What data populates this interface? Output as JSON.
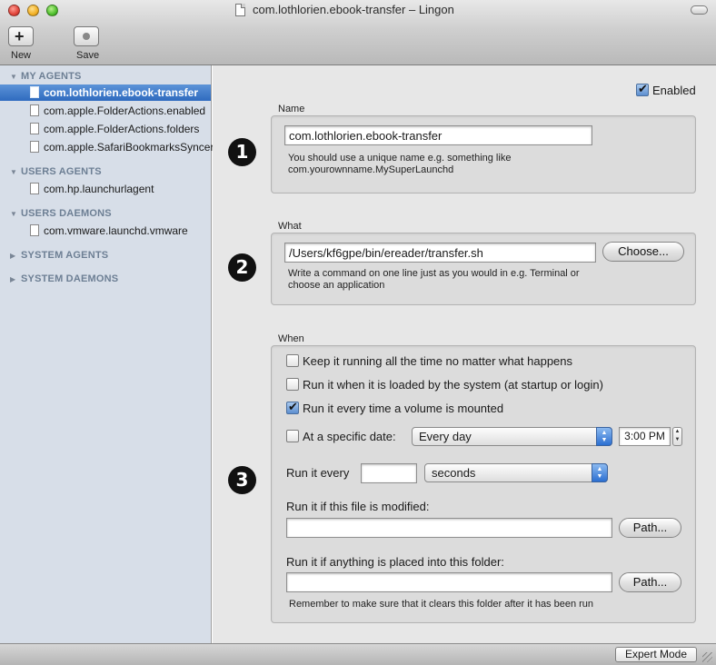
{
  "window": {
    "title": "com.lothlorien.ebook-transfer – Lingon"
  },
  "toolbar": {
    "new_label": "New",
    "save_label": "Save"
  },
  "sidebar": {
    "groups": [
      {
        "label": "MY AGENTS",
        "expanded": true,
        "items": [
          "com.lothlorien.ebook-transfer",
          "com.apple.FolderActions.enabled",
          "com.apple.FolderActions.folders",
          "com.apple.SafariBookmarksSyncer"
        ]
      },
      {
        "label": "USERS AGENTS",
        "expanded": true,
        "items": [
          "com.hp.launchurlagent"
        ]
      },
      {
        "label": "USERS DAEMONS",
        "expanded": true,
        "items": [
          "com.vmware.launchd.vmware"
        ]
      },
      {
        "label": "SYSTEM AGENTS",
        "expanded": false,
        "items": []
      },
      {
        "label": "SYSTEM DAEMONS",
        "expanded": false,
        "items": []
      }
    ],
    "selected_item": "com.lothlorien.ebook-transfer"
  },
  "main": {
    "enabled_label": "Enabled",
    "enabled_checked": true,
    "name_section": {
      "badge": "1",
      "title": "Name",
      "value": "com.lothlorien.ebook-transfer",
      "hint_line1": "You should use a unique name e.g. something like",
      "hint_line2": "com.yourownname.MySuperLaunchd"
    },
    "what_section": {
      "badge": "2",
      "title": "What",
      "value": "/Users/kf6gpe/bin/ereader/transfer.sh",
      "choose_label": "Choose...",
      "hint_line1": "Write a command on one line just as you would in e.g. Terminal or",
      "hint_line2": "choose an application"
    },
    "when_section": {
      "badge": "3",
      "title": "When",
      "keep_running_label": "Keep it running all the time no matter what happens",
      "keep_running_checked": false,
      "run_loaded_label": "Run it when it is loaded by the system (at startup or login)",
      "run_loaded_checked": false,
      "run_volume_label": "Run it every time a volume is mounted",
      "run_volume_checked": true,
      "specific_date_label": "At a specific date:",
      "specific_date_checked": false,
      "date_option": "Every day",
      "time_value": "3:00 PM",
      "run_every_label": "Run it every",
      "run_every_value": "",
      "interval_unit": "seconds",
      "file_modified_label": "Run it if this file is modified:",
      "file_modified_value": "",
      "path_label": "Path...",
      "folder_label": "Run it if anything is placed into this folder:",
      "folder_value": "",
      "folder_hint": "Remember to make sure that it clears this folder after it has been run"
    }
  },
  "bottombar": {
    "expert_mode_label": "Expert Mode"
  }
}
